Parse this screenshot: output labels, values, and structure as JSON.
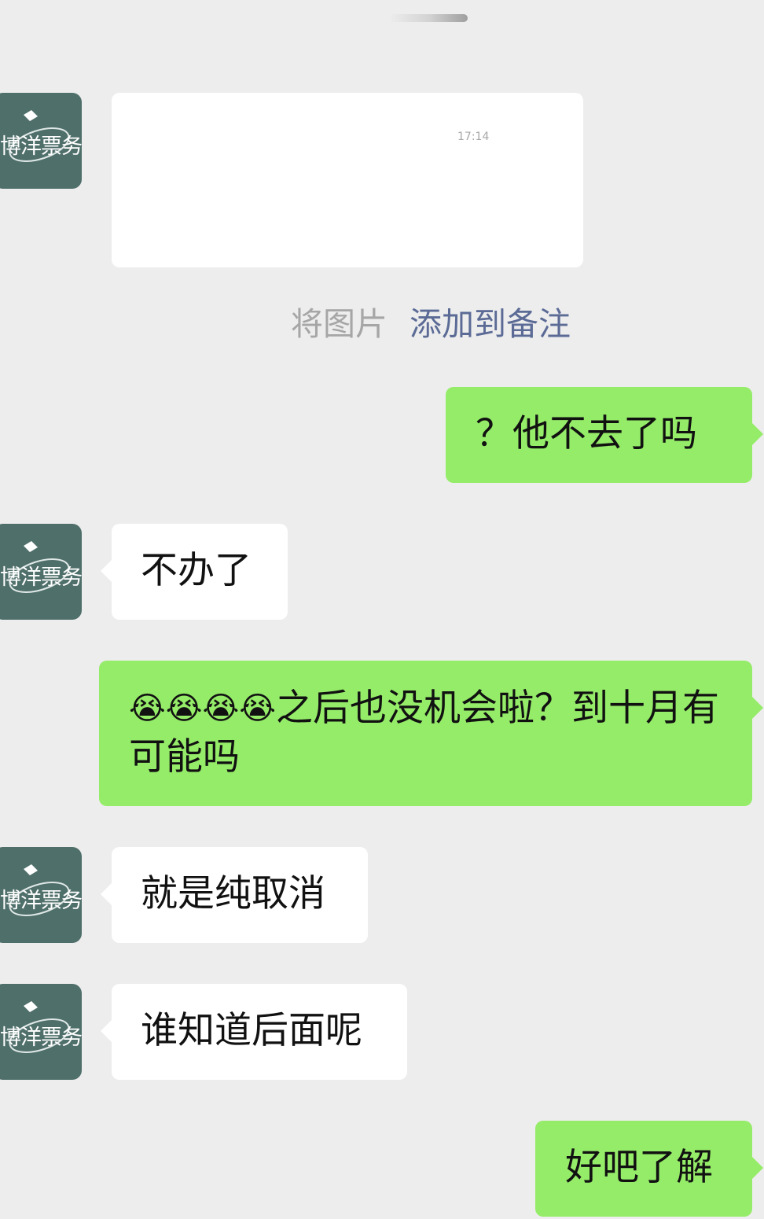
{
  "chat": {
    "avatar_text": "博洋票务",
    "image_message": {
      "timestamp": "17:14"
    },
    "system_note": {
      "prefix": "将图片",
      "link": "添加到备注"
    },
    "messages": [
      {
        "direction": "outgoing",
        "text": "？他不去了吗"
      },
      {
        "direction": "incoming",
        "text": "不办了"
      },
      {
        "direction": "outgoing",
        "emoji": [
          "😭",
          "😭",
          "😭",
          "😭"
        ],
        "text": "之后也没机会啦？到十月有可能吗"
      },
      {
        "direction": "incoming",
        "text": "就是纯取消"
      },
      {
        "direction": "incoming",
        "text": "谁知道后面呢"
      },
      {
        "direction": "outgoing",
        "text": "好吧了解"
      }
    ]
  },
  "colors": {
    "background": "#ededed",
    "incoming_bubble": "#ffffff",
    "outgoing_bubble": "#95ec69",
    "avatar": "#4f6f6a",
    "link": "#5b6b96"
  }
}
